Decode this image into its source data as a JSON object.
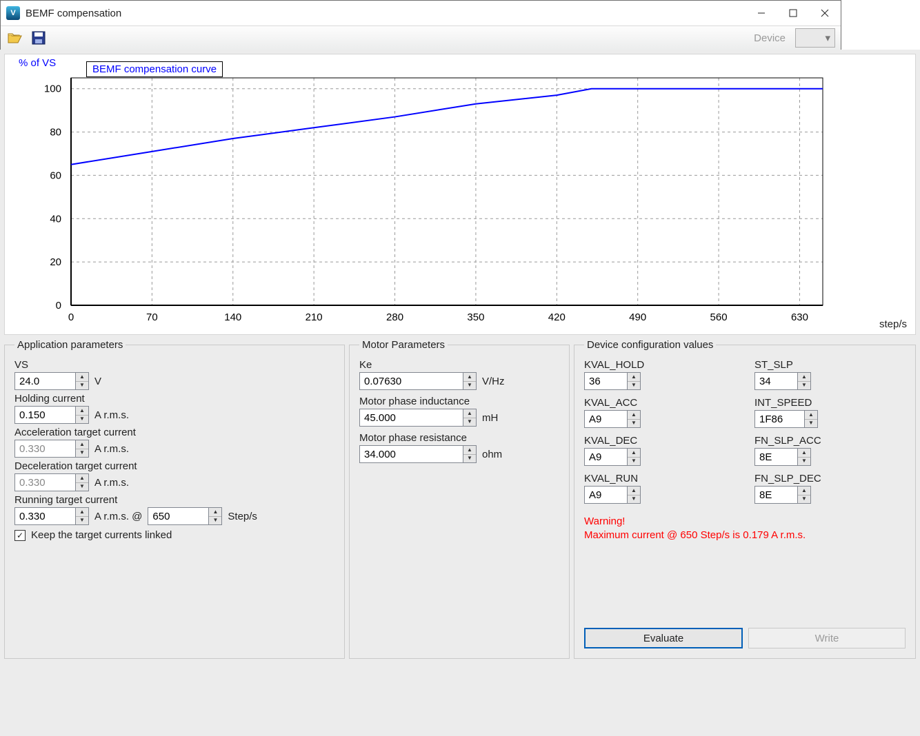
{
  "window": {
    "title": "BEMF compensation"
  },
  "toolbar": {
    "device_label": "Device"
  },
  "chart_data": {
    "type": "line",
    "title": "BEMF compensation curve",
    "ylabel": "% of VS",
    "xlabel": "step/s",
    "xlim": [
      0,
      650
    ],
    "ylim": [
      0,
      105
    ],
    "xticks": [
      0,
      70,
      140,
      210,
      280,
      350,
      420,
      490,
      560,
      630
    ],
    "yticks": [
      0,
      20,
      40,
      60,
      80,
      100
    ],
    "series": [
      {
        "name": "BEMF compensation curve",
        "x": [
          0,
          70,
          140,
          210,
          280,
          350,
          420,
          450,
          650
        ],
        "y": [
          65,
          71,
          77,
          82,
          87,
          93,
          97,
          100,
          100
        ]
      }
    ]
  },
  "app_params": {
    "legend": "Application parameters",
    "vs": {
      "label": "VS",
      "value": "24.0",
      "unit": "V"
    },
    "holding": {
      "label": "Holding current",
      "value": "0.150",
      "unit": "A r.m.s."
    },
    "accel": {
      "label": "Acceleration target current",
      "value": "0.330",
      "unit": "A r.m.s.",
      "disabled": true
    },
    "decel": {
      "label": "Deceleration target current",
      "value": "0.330",
      "unit": "A r.m.s.",
      "disabled": true
    },
    "running": {
      "label": "Running target current",
      "value": "0.330",
      "unit_a": "A r.m.s. @",
      "speed": "650",
      "unit_b": "Step/s"
    },
    "link": {
      "checked": true,
      "label": "Keep the target currents linked"
    }
  },
  "motor_params": {
    "legend": "Motor Parameters",
    "ke": {
      "label": "Ke",
      "value": "0.07630",
      "unit": "V/Hz"
    },
    "ind": {
      "label": "Motor phase inductance",
      "value": "45.000",
      "unit": "mH"
    },
    "res": {
      "label": "Motor phase resistance",
      "value": "34.000",
      "unit": "ohm"
    }
  },
  "dev_params": {
    "legend": "Device configuration values",
    "kval_hold": {
      "label": "KVAL_HOLD",
      "value": "36"
    },
    "st_slp": {
      "label": "ST_SLP",
      "value": "34"
    },
    "kval_acc": {
      "label": "KVAL_ACC",
      "value": "A9"
    },
    "int_speed": {
      "label": "INT_SPEED",
      "value": "1F86"
    },
    "kval_dec": {
      "label": "KVAL_DEC",
      "value": "A9"
    },
    "fn_slp_acc": {
      "label": "FN_SLP_ACC",
      "value": "8E"
    },
    "kval_run": {
      "label": "KVAL_RUN",
      "value": "A9"
    },
    "fn_slp_dec": {
      "label": "FN_SLP_DEC",
      "value": "8E"
    },
    "warning": "Warning!\nMaximum current @ 650 Step/s is 0.179 A r.m.s.",
    "evaluate": "Evaluate",
    "write": "Write"
  }
}
